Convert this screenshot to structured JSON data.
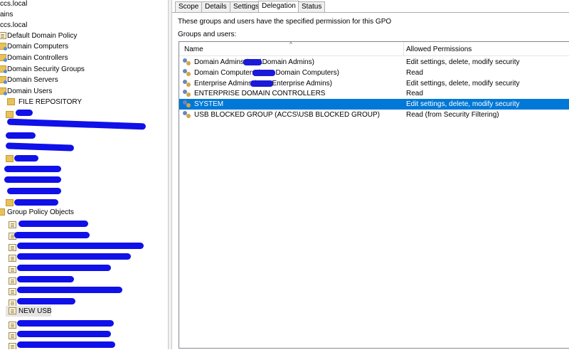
{
  "tree": {
    "domain_label": "ccs.local",
    "domains_label": "ains",
    "domain2_label": "ccs.local",
    "items": [
      {
        "label": "Default Domain Policy"
      },
      {
        "label": "Domain Computers"
      },
      {
        "label": "Domain Controllers"
      },
      {
        "label": "Domain Security Groups"
      },
      {
        "label": "Domain Servers"
      },
      {
        "label": "Domain Users"
      },
      {
        "label": "FILE REPOSITORY"
      }
    ],
    "gpo_label": "Group Policy Objects",
    "new_usb_label": "NEW USB"
  },
  "tabs": [
    "Scope",
    "Details",
    "Settings",
    "Delegation",
    "Status"
  ],
  "active_tab": "Delegation",
  "delegation": {
    "description": "These groups and users have the specified permission for this GPO",
    "groups_label": "Groups and users:",
    "columns": {
      "name": "Name",
      "permissions": "Allowed Permissions"
    },
    "rows": [
      {
        "name": "Domain Admins (      \\Domain Admins)",
        "permissions": "Edit settings, delete, modify security"
      },
      {
        "name": "Domain Computers (        Domain Computers)",
        "permissions": "Read"
      },
      {
        "name": "Enterprise Admins (        Enterprise Admins)",
        "permissions": "Edit settings, delete, modify security"
      },
      {
        "name": "ENTERPRISE DOMAIN CONTROLLERS",
        "permissions": "Read"
      },
      {
        "name": "SYSTEM",
        "permissions": "Edit settings, delete, modify security"
      },
      {
        "name": "USB BLOCKED GROUP (ACCS\\USB BLOCKED GROUP)",
        "permissions": "Read (from Security Filtering)"
      }
    ],
    "selected_row": 4
  },
  "colors": {
    "selection": "#0078d7",
    "redaction": "#1010e8"
  }
}
